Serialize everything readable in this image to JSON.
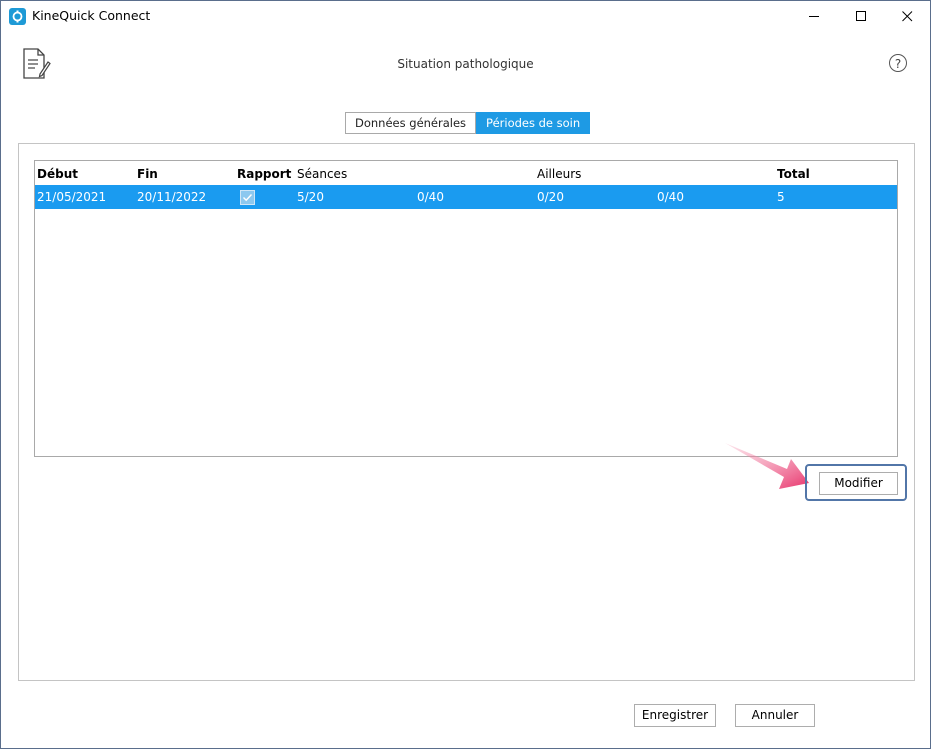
{
  "window": {
    "title": "KineQuick Connect"
  },
  "header": {
    "title": "Situation pathologique",
    "help_glyph": "?"
  },
  "tabs": [
    {
      "label": "Données générales",
      "active": false
    },
    {
      "label": "Périodes de soin",
      "active": true
    }
  ],
  "table": {
    "headers": {
      "debut": "Début",
      "fin": "Fin",
      "rapport": "Rapport",
      "seances": "Séances",
      "ailleurs": "Ailleurs",
      "total": "Total"
    },
    "rows": [
      {
        "debut": "21/05/2021",
        "fin": "20/11/2022",
        "rapport": true,
        "seances_a": "5/20",
        "seances_b": "0/40",
        "ailleurs_a": "0/20",
        "ailleurs_b": "0/40",
        "total": "5",
        "selected": true
      }
    ]
  },
  "buttons": {
    "modifier": "Modifier",
    "enregistrer": "Enregistrer",
    "annuler": "Annuler"
  },
  "colors": {
    "accent": "#1e9ae4",
    "selection": "#1a9bf0",
    "arrow": "#ea3a6e"
  }
}
